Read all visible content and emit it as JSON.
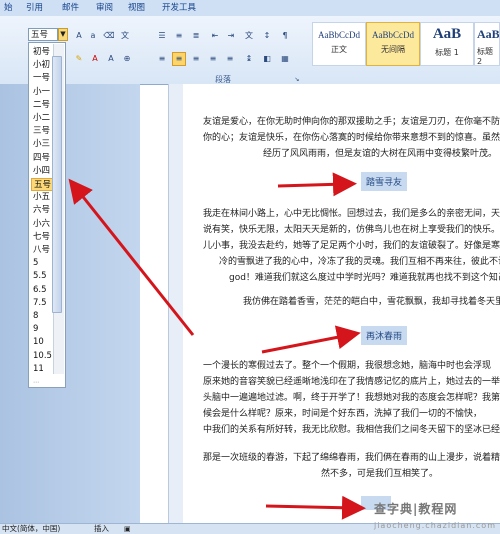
{
  "tabs": [
    "始",
    "引用",
    "邮件",
    "审阅",
    "视图",
    "开发工具"
  ],
  "ribbon": {
    "font_size_value": "五号",
    "paragraph_group_label": "段落",
    "styles": [
      {
        "preview": "AaBbCcDd",
        "name": "正文",
        "selected": false
      },
      {
        "preview": "AaBbCcDd",
        "name": "无间隔",
        "selected": true
      },
      {
        "preview": "AaB",
        "name": "标题 1",
        "selected": false
      },
      {
        "preview": "AaBb",
        "name": "标题 2",
        "selected": false
      }
    ]
  },
  "font_sizes": [
    "初号",
    "小初",
    "一号",
    "小一",
    "二号",
    "小二",
    "三号",
    "小三",
    "四号",
    "小四",
    "五号",
    "小五",
    "六号",
    "小六",
    "七号",
    "八号",
    "5",
    "5.5",
    "6.5",
    "7.5",
    "8",
    "9",
    "10",
    "10.5",
    "11"
  ],
  "selected_font_size": "五号",
  "document": {
    "paragraphs": [
      "友谊是爱心，在你无助时伸向你的那双援助之手；友谊是刀刃，在你毫不防",
      "你的心；友谊是快乐，在你伤心落寞的时候给你带来意想不到的惊喜。虽然",
      "经历了风风雨雨，但是友谊的大树在风雨中变得枝繁叶茂。"
    ],
    "heading1": "踏雪寻友",
    "paragraphs2": [
      "我走在林间小路上，心中无比惆怅。回想过去，我们是多么的亲密无间，天",
      "说有笑，快乐无限，太阳天天是新的，仿佛鸟儿也在树上享受我们的快乐。",
      "儿小事，我没去赴约，她等了足足两个小时，我们的友谊破裂了。好像是寒",
      "冷的雪飘进了我的心中，冷冻了我的灵魂。我们互相不再来往，彼此不说话",
      "god！难道我们就这么度过中学时光吗？难道我就再也找不到这个知己了吗"
    ],
    "para3": "我仿佛在踏着香雪，茫茫的皑白中，雪花飘飘，我却寻找着冬天里的一",
    "heading2": "再沐春雨",
    "paragraphs4": [
      "一个漫长的寒假过去了。整个一个假期，我很想念她，脑海中时也会浮现",
      "原来她的音容笑貌已经遥晰地浅印在了我情感记忆的底片上，她过去的一举",
      "头脑中一遍遍地过滤。啊，终于开学了！我想她对我的态度会怎样呢？我第",
      "候会是什么样呢？原来，时间是个好东西，洗掉了我们一切的不愉快，",
      "中我们的关系有所好转，我无比欣慰。我相信我们之间冬天留下的坚冰已经"
    ],
    "paragraphs5": [
      "那是一次班级的春游，下起了绵绵春雨，我们俩在春雨的山上漫步，说着精",
      "然不多，可是我们互相笑了。"
    ]
  },
  "status_bar": {
    "language": "中文(简体，中国)",
    "mode": "插入"
  },
  "watermark": {
    "main": "查字典|教程网",
    "sub": "jiaocheng.chazidian.com"
  }
}
